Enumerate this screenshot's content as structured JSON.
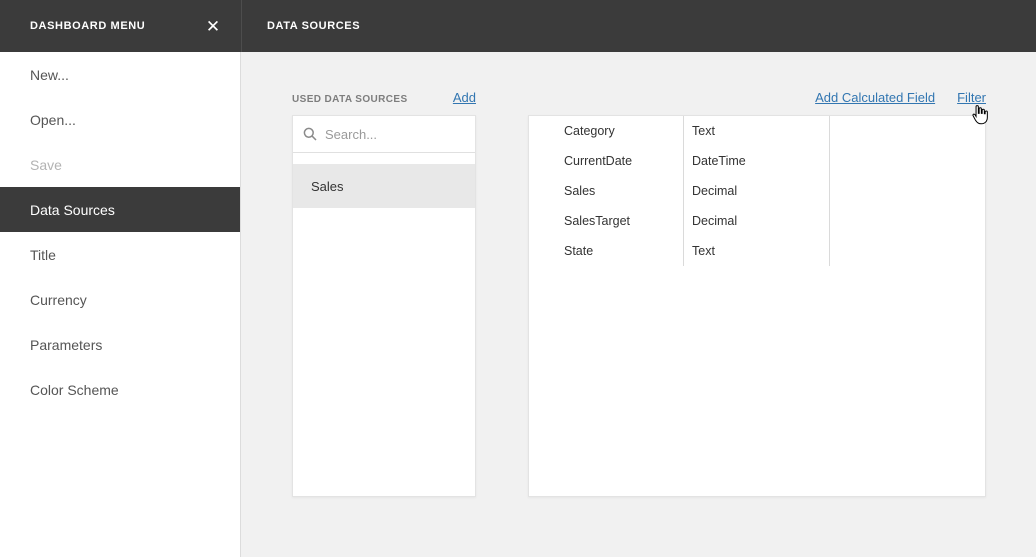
{
  "sidebar": {
    "title": "DASHBOARD MENU",
    "items": [
      {
        "label": "New...",
        "state": "normal"
      },
      {
        "label": "Open...",
        "state": "normal"
      },
      {
        "label": "Save",
        "state": "disabled"
      },
      {
        "label": "Data Sources",
        "state": "selected"
      },
      {
        "label": "Title",
        "state": "normal"
      },
      {
        "label": "Currency",
        "state": "normal"
      },
      {
        "label": "Parameters",
        "state": "normal"
      },
      {
        "label": "Color Scheme",
        "state": "normal"
      }
    ]
  },
  "header": {
    "title": "DATA SOURCES"
  },
  "used_sources": {
    "label": "USED DATA SOURCES",
    "add_label": "Add",
    "search_placeholder": "Search...",
    "items": [
      {
        "name": "Sales",
        "selected": true
      }
    ]
  },
  "fields_panel": {
    "add_calculated_field_label": "Add Calculated Field",
    "filter_label": "Filter",
    "fields": [
      {
        "name": "Category",
        "type": "Text"
      },
      {
        "name": "CurrentDate",
        "type": "DateTime"
      },
      {
        "name": "Sales",
        "type": "Decimal"
      },
      {
        "name": "SalesTarget",
        "type": "Decimal"
      },
      {
        "name": "State",
        "type": "Text"
      }
    ]
  },
  "colors": {
    "dark_header": "#3b3b3b",
    "selected_item_bg": "#3b3b3b",
    "link_blue": "#3276b1",
    "content_bg": "#f1f1f1",
    "selected_source_bg": "#e8e8e8"
  }
}
